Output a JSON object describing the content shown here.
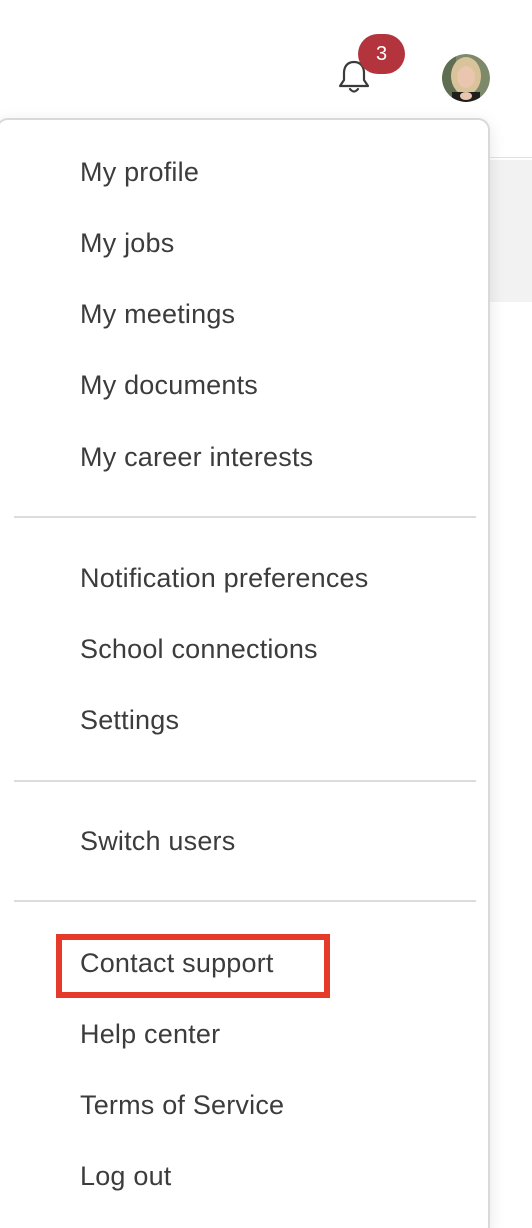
{
  "header": {
    "notifications_badge": "3",
    "bell_icon": "bell-icon",
    "avatar_icon": "user-avatar"
  },
  "menu": {
    "group_1": [
      {
        "label": "My profile"
      },
      {
        "label": "My jobs"
      },
      {
        "label": "My meetings"
      },
      {
        "label": "My documents"
      },
      {
        "label": "My career interests"
      }
    ],
    "group_2": [
      {
        "label": "Notification preferences"
      },
      {
        "label": "School connections"
      },
      {
        "label": "Settings"
      }
    ],
    "group_3": [
      {
        "label": "Switch users"
      }
    ],
    "group_4": [
      {
        "label": "Contact support"
      },
      {
        "label": "Help center"
      },
      {
        "label": "Terms of Service"
      },
      {
        "label": "Log out"
      }
    ]
  },
  "colors": {
    "badge": "#b3343c",
    "highlight_box": "#e5392a",
    "text": "#3c3c3c"
  }
}
